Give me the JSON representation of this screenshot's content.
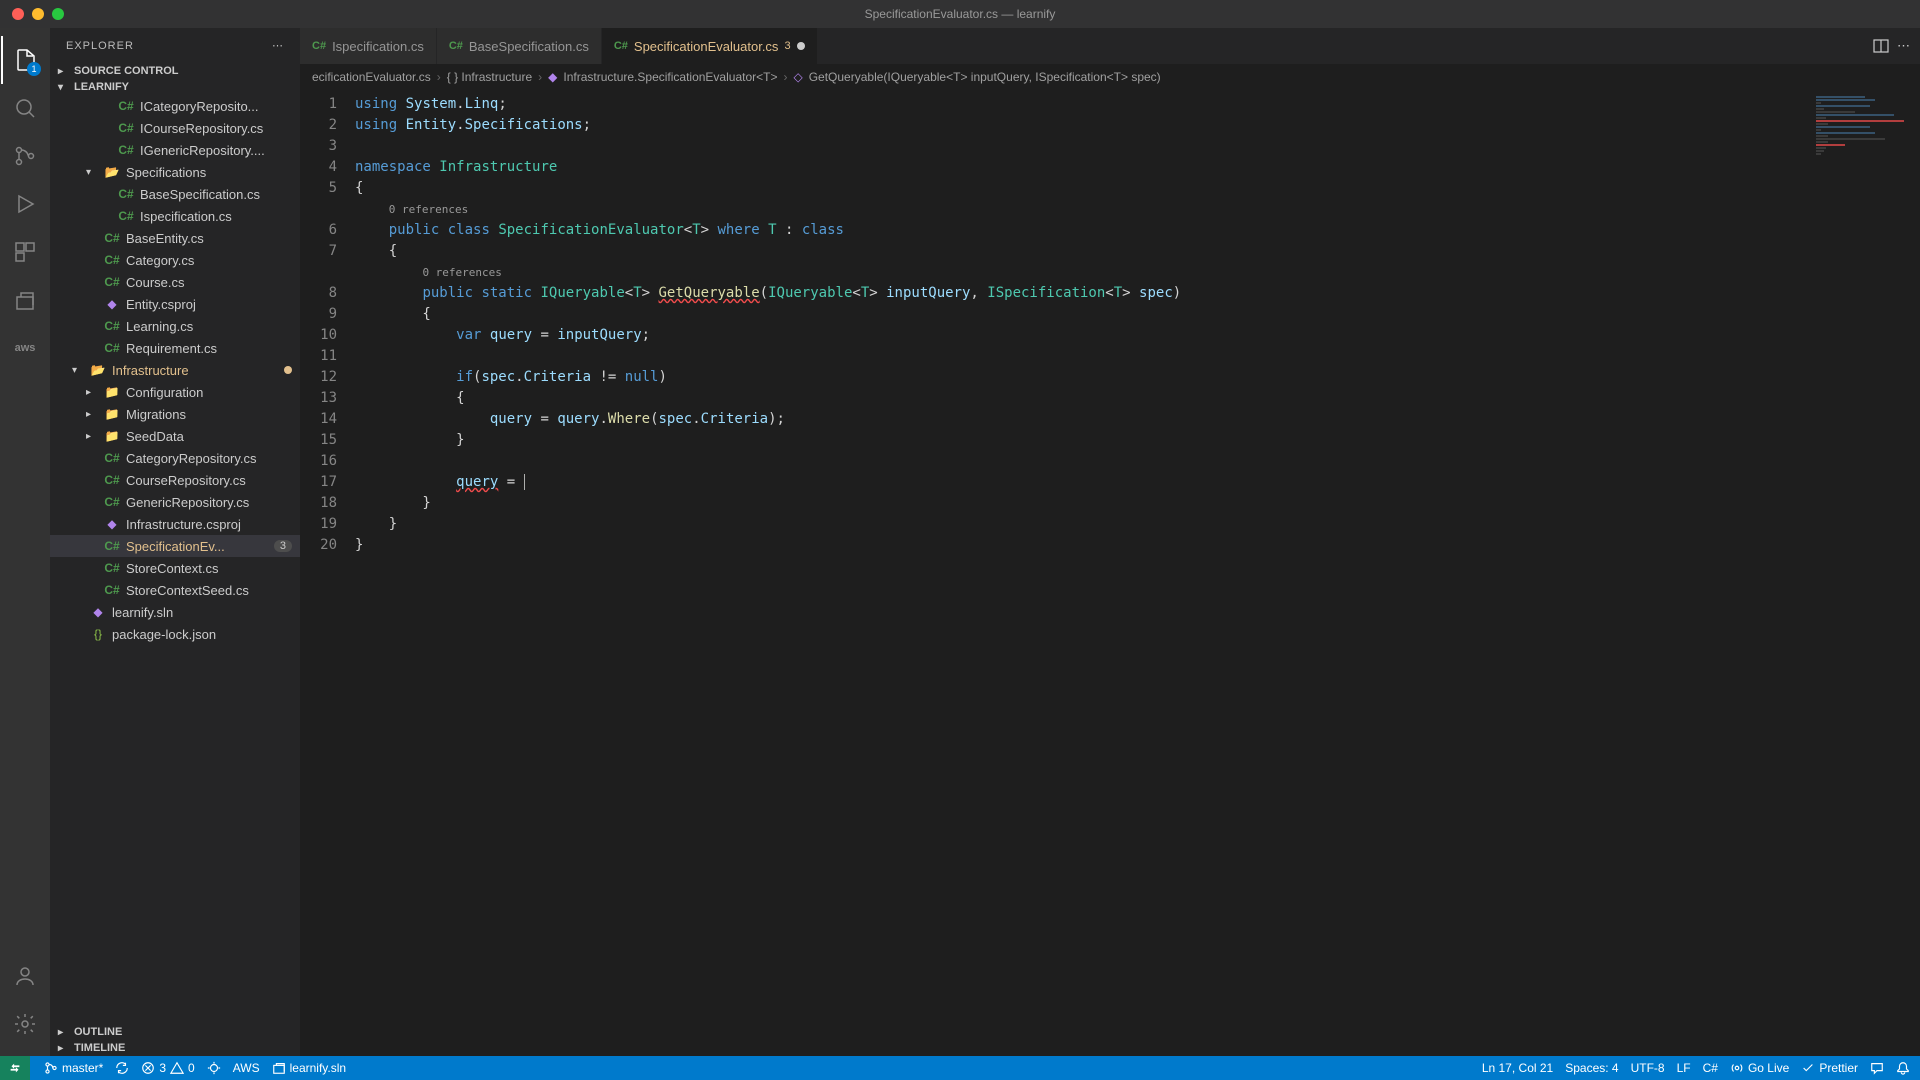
{
  "window": {
    "title": "SpecificationEvaluator.cs — learnify"
  },
  "activity": {
    "badge": "1"
  },
  "sidebar": {
    "title": "EXPLORER",
    "sections": {
      "source_control": "SOURCE CONTROL",
      "project": "LEARNIFY",
      "outline": "OUTLINE",
      "timeline": "TIMELINE"
    },
    "tree": [
      {
        "name": "ICategoryReposito...",
        "icon": "cs",
        "indent": 3
      },
      {
        "name": "ICourseRepository.cs",
        "icon": "cs",
        "indent": 3
      },
      {
        "name": "IGenericRepository....",
        "icon": "cs",
        "indent": 3
      },
      {
        "name": "Specifications",
        "icon": "folder-open",
        "indent": 2,
        "chev": "▾"
      },
      {
        "name": "BaseSpecification.cs",
        "icon": "cs",
        "indent": 3
      },
      {
        "name": "Ispecification.cs",
        "icon": "cs",
        "indent": 3
      },
      {
        "name": "BaseEntity.cs",
        "icon": "cs",
        "indent": 2
      },
      {
        "name": "Category.cs",
        "icon": "cs",
        "indent": 2
      },
      {
        "name": "Course.cs",
        "icon": "cs",
        "indent": 2
      },
      {
        "name": "Entity.csproj",
        "icon": "sln",
        "indent": 2
      },
      {
        "name": "Learning.cs",
        "icon": "cs",
        "indent": 2
      },
      {
        "name": "Requirement.cs",
        "icon": "cs",
        "indent": 2
      },
      {
        "name": "Infrastructure",
        "icon": "folder-open",
        "indent": 1,
        "chev": "▾",
        "modified": true,
        "dot": true
      },
      {
        "name": "Configuration",
        "icon": "folder",
        "indent": 2,
        "chev": "▸"
      },
      {
        "name": "Migrations",
        "icon": "folder",
        "indent": 2,
        "chev": "▸"
      },
      {
        "name": "SeedData",
        "icon": "folder",
        "indent": 2,
        "chev": "▸"
      },
      {
        "name": "CategoryRepository.cs",
        "icon": "cs",
        "indent": 2
      },
      {
        "name": "CourseRepository.cs",
        "icon": "cs",
        "indent": 2
      },
      {
        "name": "GenericRepository.cs",
        "icon": "cs",
        "indent": 2
      },
      {
        "name": "Infrastructure.csproj",
        "icon": "sln",
        "indent": 2
      },
      {
        "name": "SpecificationEv...",
        "icon": "cs",
        "indent": 2,
        "modified": true,
        "active": true,
        "problems": "3"
      },
      {
        "name": "StoreContext.cs",
        "icon": "cs",
        "indent": 2
      },
      {
        "name": "StoreContextSeed.cs",
        "icon": "cs",
        "indent": 2
      },
      {
        "name": "learnify.sln",
        "icon": "sln",
        "indent": 1
      },
      {
        "name": "package-lock.json",
        "icon": "json",
        "indent": 1
      }
    ]
  },
  "tabs": [
    {
      "label": "Ispecification.cs",
      "active": false
    },
    {
      "label": "BaseSpecification.cs",
      "active": false
    },
    {
      "label": "SpecificationEvaluator.cs",
      "active": true,
      "problems": "3",
      "dirty": true
    }
  ],
  "breadcrumbs": [
    "ecificationEvaluator.cs",
    "{ } Infrastructure",
    "Infrastructure.SpecificationEvaluator<T>",
    "GetQueryable(IQueryable<T> inputQuery, ISpecification<T> spec)"
  ],
  "code": {
    "ref0": "0 references",
    "ref1": "0 references",
    "lines": [
      1,
      2,
      3,
      4,
      5,
      6,
      7,
      8,
      9,
      10,
      11,
      12,
      13,
      14,
      15,
      16,
      17,
      18,
      19,
      20
    ]
  },
  "statusbar": {
    "branch": "master*",
    "errors": "3",
    "warnings": "0",
    "aws": "AWS",
    "sln": "learnify.sln",
    "position": "Ln 17, Col 21",
    "spaces": "Spaces: 4",
    "encoding": "UTF-8",
    "eol": "LF",
    "lang": "C#",
    "live": "Go Live",
    "prettier": "Prettier"
  }
}
